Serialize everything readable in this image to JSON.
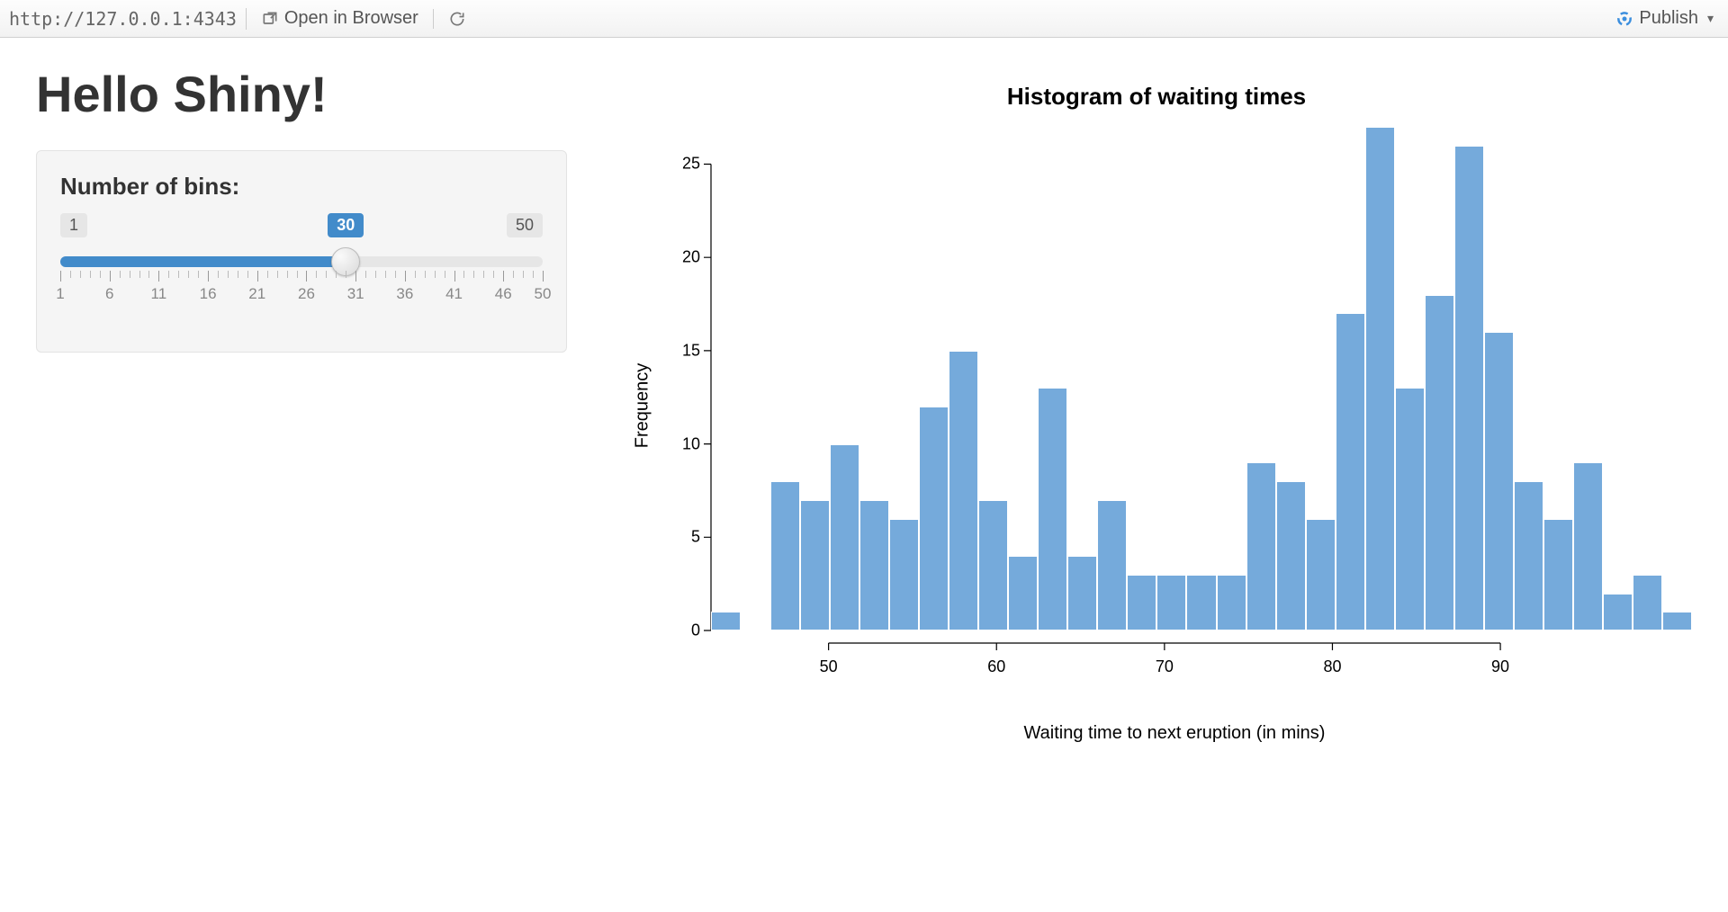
{
  "toolbar": {
    "url": "http://127.0.0.1:4343",
    "open_in_browser": "Open in Browser",
    "publish": "Publish"
  },
  "app": {
    "title": "Hello Shiny!"
  },
  "sidebar": {
    "slider": {
      "label": "Number of bins:",
      "min": 1,
      "max": 50,
      "value": 30,
      "tick_labels": [
        1,
        6,
        11,
        16,
        21,
        26,
        31,
        36,
        41,
        46,
        50
      ]
    }
  },
  "chart_data": {
    "type": "bar",
    "title": "Histogram of waiting times",
    "xlabel": "Waiting time to next eruption (in mins)",
    "ylabel": "Frequency",
    "ylim": [
      0,
      27
    ],
    "yticks": [
      0,
      5,
      10,
      15,
      20,
      25
    ],
    "xticks": [
      50,
      60,
      70,
      80,
      90
    ],
    "bin_start": 43,
    "bin_width": 1.77,
    "values": [
      1,
      0,
      8,
      7,
      10,
      7,
      6,
      12,
      15,
      7,
      4,
      13,
      4,
      7,
      3,
      3,
      3,
      3,
      9,
      8,
      6,
      17,
      27,
      13,
      18,
      26,
      16,
      8,
      6,
      9,
      2,
      3,
      1
    ],
    "bar_color": "#75aadb"
  }
}
